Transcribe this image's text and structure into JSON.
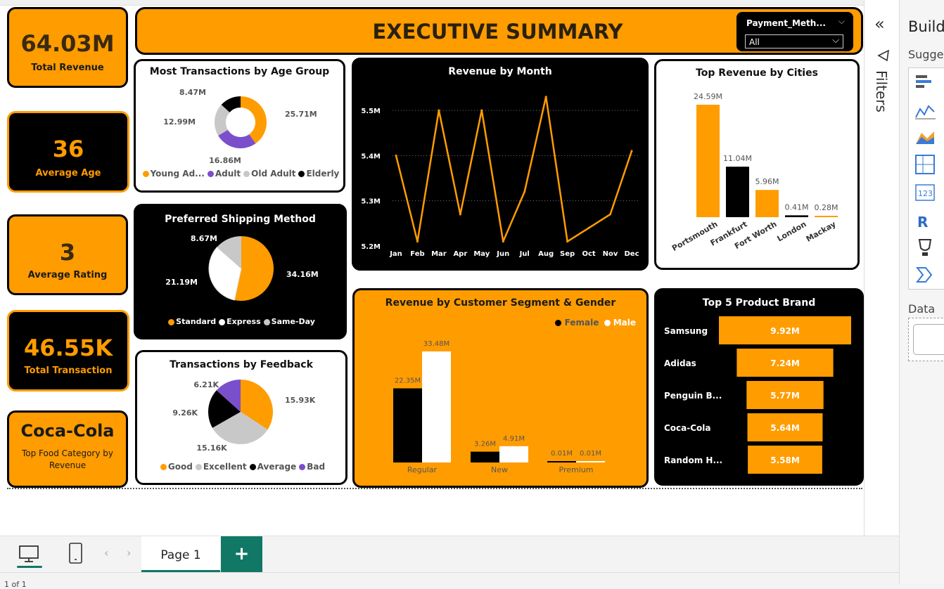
{
  "kpis": {
    "total_revenue": {
      "value": "64.03M",
      "label": "Total Revenue"
    },
    "average_age": {
      "value": "36",
      "label": "Average Age"
    },
    "average_rating": {
      "value": "3",
      "label": "Average Rating"
    },
    "total_transaction": {
      "value": "46.55K",
      "label": "Total Transaction"
    },
    "top_food": {
      "value": "Coca-Cola",
      "label": "Top Food Category by Revenue"
    }
  },
  "header": {
    "title": "EXECUTIVE SUMMARY"
  },
  "slicer": {
    "title": "Payment_Meth...",
    "value": "All"
  },
  "colors": {
    "orange": "#FF9C00",
    "black": "#000000",
    "purple": "#7B4FCB",
    "grey": "#C8C8C8",
    "white": "#FFFFFF"
  },
  "age_group": {
    "title": "Most Transactions by Age Group",
    "chart_data": {
      "type": "pie",
      "donut": true,
      "labels": [
        "Young Adult",
        "Adult",
        "Old Adult",
        "Elderly"
      ],
      "legend_labels": [
        "Young Ad...",
        "Adult",
        "Old Adult",
        "Elderly"
      ],
      "values": [
        25.71,
        16.86,
        12.99,
        8.47
      ],
      "value_labels": [
        "25.71M",
        "16.86M",
        "12.99M",
        "8.47M"
      ],
      "colors": [
        "#FF9C00",
        "#7B4FCB",
        "#C8C8C8",
        "#000000"
      ]
    }
  },
  "shipping": {
    "title": "Preferred Shipping Method",
    "chart_data": {
      "type": "pie",
      "labels": [
        "Standard",
        "Express",
        "Same-Day"
      ],
      "values": [
        34.16,
        21.19,
        8.67
      ],
      "value_labels": [
        "34.16M",
        "21.19M",
        "8.67M"
      ],
      "colors": [
        "#FF9C00",
        "#FFFFFF",
        "#C8C8C8"
      ]
    }
  },
  "feedback": {
    "title": "Transactions by Feedback",
    "chart_data": {
      "type": "pie",
      "labels": [
        "Good",
        "Excellent",
        "Average",
        "Bad"
      ],
      "values": [
        15.93,
        15.16,
        9.26,
        6.21
      ],
      "value_labels": [
        "15.93K",
        "15.16K",
        "9.26K",
        "6.21K"
      ],
      "colors": [
        "#FF9C00",
        "#C8C8C8",
        "#000000",
        "#7B4FCB"
      ]
    }
  },
  "monthly": {
    "title": "Revenue by Month",
    "chart_data": {
      "type": "line",
      "x": [
        "Jan",
        "Feb",
        "Mar",
        "Apr",
        "May",
        "Jun",
        "Jul",
        "Aug",
        "Sep",
        "Oct",
        "Nov",
        "Dec"
      ],
      "values": [
        5.4,
        5.21,
        5.5,
        5.27,
        5.5,
        5.21,
        5.32,
        5.53,
        5.21,
        5.24,
        5.27,
        5.41
      ],
      "ylim": [
        5.2,
        5.5
      ],
      "y_ticks": [
        "5.5M",
        "5.4M",
        "5.3M",
        "5.2M"
      ],
      "grid": true
    }
  },
  "cities": {
    "title": "Top Revenue by Cities",
    "chart_data": {
      "type": "bar",
      "categories": [
        "Portsmouth",
        "Frankfurt",
        "Fort Worth",
        "London",
        "Mackay"
      ],
      "values": [
        24.59,
        11.04,
        5.96,
        0.41,
        0.28
      ],
      "value_labels": [
        "24.59M",
        "11.04M",
        "5.96M",
        "0.41M",
        "0.28M"
      ],
      "colors": [
        "#FF9C00",
        "#000000",
        "#FF9C00",
        "#000000",
        "#FF9C00"
      ]
    }
  },
  "segment": {
    "title": "Revenue by Customer Segment & Gender",
    "legend": [
      "Female",
      "Male"
    ],
    "chart_data": {
      "type": "bar",
      "categories": [
        "Regular",
        "New",
        "Premium"
      ],
      "series": [
        {
          "name": "Female",
          "values": [
            22.35,
            3.26,
            0.01
          ],
          "value_labels": [
            "22.35M",
            "3.26M",
            "0.01M"
          ],
          "color": "#000000"
        },
        {
          "name": "Male",
          "values": [
            33.48,
            4.91,
            0.01
          ],
          "value_labels": [
            "33.48M",
            "4.91M",
            "0.01M"
          ],
          "color": "#FFFFFF"
        }
      ]
    }
  },
  "brands": {
    "title": "Top 5 Product Brand",
    "chart_data": {
      "type": "bar",
      "orientation": "funnel",
      "categories": [
        "Samsung",
        "Adidas",
        "Penguin B...",
        "Coca-Cola",
        "Random H..."
      ],
      "values": [
        9.92,
        7.24,
        5.77,
        5.64,
        5.58
      ],
      "value_labels": [
        "9.92M",
        "7.24M",
        "5.77M",
        "5.64M",
        "5.58M"
      ]
    }
  },
  "filters": {
    "label": "Filters"
  },
  "build": {
    "title": "Build",
    "suggest": "Sugges",
    "data": "Data"
  },
  "pages": {
    "tab": "Page 1",
    "add": "+"
  },
  "status": {
    "text": "1 of 1"
  }
}
